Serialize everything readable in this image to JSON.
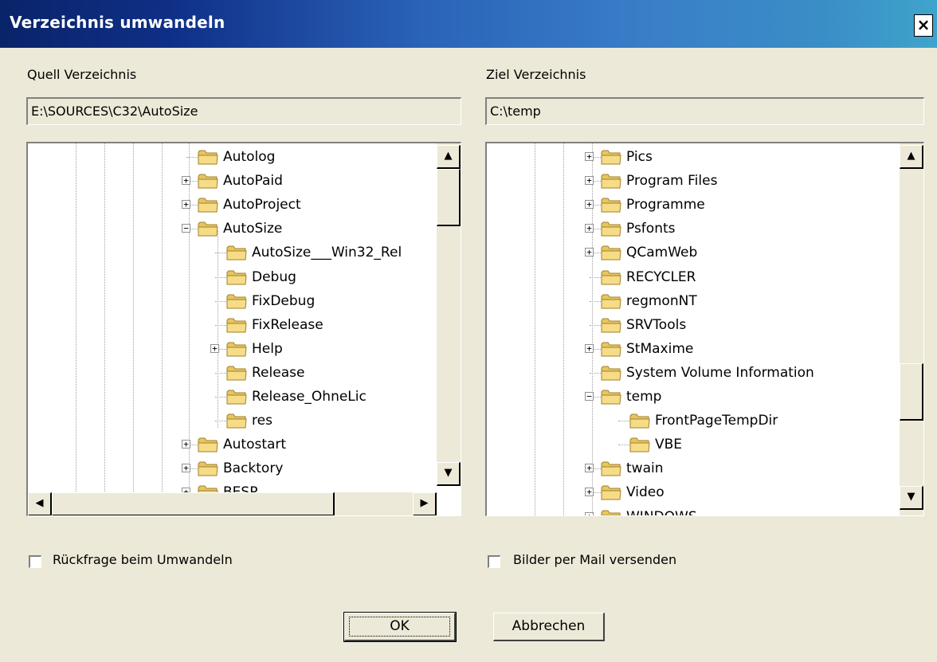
{
  "window": {
    "title": "Verzeichnis umwandeln",
    "close_label": "×"
  },
  "source": {
    "label": "Quell Verzeichnis",
    "path": "E:\\SOURCES\\C32\\AutoSize",
    "tree": [
      {
        "label": "Autolog",
        "level": 0,
        "expander": ""
      },
      {
        "label": "AutoPaid",
        "level": 0,
        "expander": "+"
      },
      {
        "label": "AutoProject",
        "level": 0,
        "expander": "+"
      },
      {
        "label": "AutoSize",
        "level": 0,
        "expander": "−"
      },
      {
        "label": "AutoSize___Win32_Rel",
        "level": 1,
        "expander": ""
      },
      {
        "label": "Debug",
        "level": 1,
        "expander": ""
      },
      {
        "label": "FixDebug",
        "level": 1,
        "expander": ""
      },
      {
        "label": "FixRelease",
        "level": 1,
        "expander": ""
      },
      {
        "label": "Help",
        "level": 1,
        "expander": "+"
      },
      {
        "label": "Release",
        "level": 1,
        "expander": ""
      },
      {
        "label": "Release_OhneLic",
        "level": 1,
        "expander": ""
      },
      {
        "label": "res",
        "level": 1,
        "expander": ""
      },
      {
        "label": "Autostart",
        "level": 0,
        "expander": "+"
      },
      {
        "label": "Backtory",
        "level": 0,
        "expander": "+"
      },
      {
        "label": "BESP",
        "level": 0,
        "expander": "+"
      }
    ]
  },
  "target": {
    "label": "Ziel Verzeichnis",
    "path": "C:\\temp",
    "tree": [
      {
        "label": "Pics",
        "level": 0,
        "expander": "+"
      },
      {
        "label": "Program Files",
        "level": 0,
        "expander": "+"
      },
      {
        "label": "Programme",
        "level": 0,
        "expander": "+"
      },
      {
        "label": "Psfonts",
        "level": 0,
        "expander": "+"
      },
      {
        "label": "QCamWeb",
        "level": 0,
        "expander": "+"
      },
      {
        "label": "RECYCLER",
        "level": 0,
        "expander": ""
      },
      {
        "label": "regmonNT",
        "level": 0,
        "expander": ""
      },
      {
        "label": "SRVTools",
        "level": 0,
        "expander": ""
      },
      {
        "label": "StMaxime",
        "level": 0,
        "expander": "+"
      },
      {
        "label": "System Volume Information",
        "level": 0,
        "expander": ""
      },
      {
        "label": "temp",
        "level": 0,
        "expander": "−"
      },
      {
        "label": "FrontPageTempDir",
        "level": 1,
        "expander": ""
      },
      {
        "label": "VBE",
        "level": 1,
        "expander": ""
      },
      {
        "label": "twain",
        "level": 0,
        "expander": "+"
      },
      {
        "label": "Video",
        "level": 0,
        "expander": "+"
      },
      {
        "label": "WINDOWS",
        "level": 0,
        "expander": "+"
      }
    ]
  },
  "options": {
    "confirm_convert": {
      "label": "Rückfrage beim Umwandeln",
      "checked": false
    },
    "mail_images": {
      "label": "Bilder per Mail versenden",
      "checked": false
    }
  },
  "buttons": {
    "ok": "OK",
    "cancel": "Abbrechen"
  },
  "icons": {
    "scroll_up": "scroll-up-arrow-icon",
    "scroll_down": "scroll-down-arrow-icon",
    "scroll_left": "scroll-left-arrow-icon",
    "scroll_right": "scroll-right-arrow-icon",
    "folder": "folder-icon"
  }
}
